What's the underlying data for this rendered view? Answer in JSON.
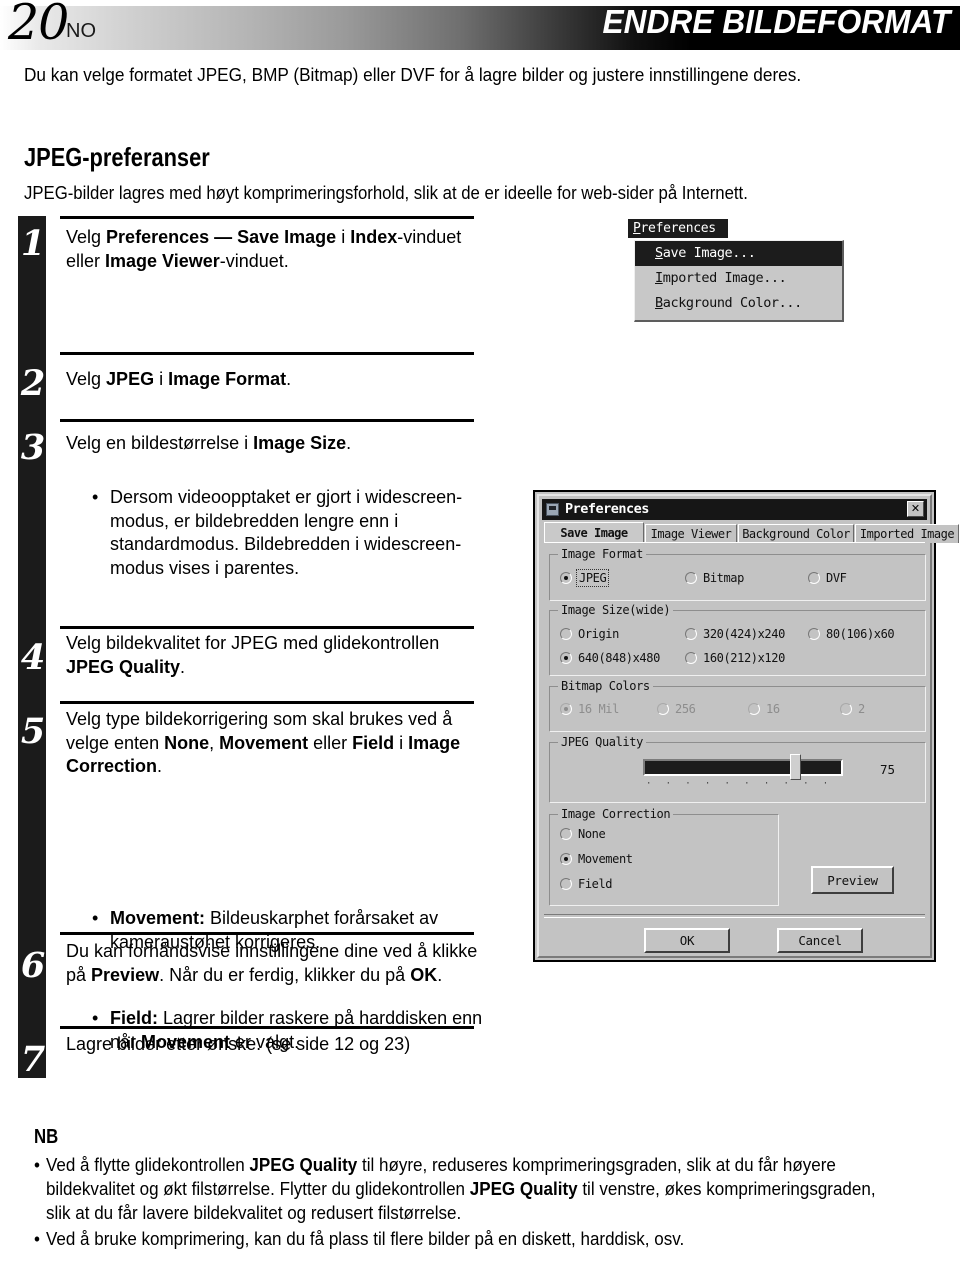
{
  "header": {
    "page_number": "20",
    "language": "NO",
    "title": "ENDRE BILDEFORMAT"
  },
  "intro": "Du kan velge formatet JPEG, BMP (Bitmap) eller DVF for å lagre bilder og justere innstillingene deres.",
  "section": {
    "heading": "JPEG-preferanser",
    "subtext": "JPEG-bilder lagres med høyt komprimeringsforhold, slik at de er ideelle for web-sider på Internett."
  },
  "steps": [
    {
      "num": "1",
      "html": "Velg <b>Preferences — Save Image</b> i <b>Index</b>-vinduet eller <b>Image Viewer</b>-vinduet."
    },
    {
      "num": "2",
      "html": "Velg <b>JPEG</b> i <b>Image Format</b>."
    },
    {
      "num": "3",
      "html": "Velg en bildestørrelse i <b>Image Size</b>."
    },
    {
      "num": "4",
      "html": "Velg bildekvalitet for JPEG med glidekontrollen <b>JPEG Quality</b>."
    },
    {
      "num": "5",
      "html": "Velg type bildekorrigering som skal brukes ved å velge enten <b>None</b>, <b>Movement</b> eller <b>Field</b> i <b>Image Correction</b>."
    },
    {
      "num": "6",
      "html": "Du kan forhåndsvise innstillingene dine ved å klikke på <b>Preview</b>. Når du er ferdig, klikker du på <b>OK</b>."
    },
    {
      "num": "7",
      "html": "Lagre bilder etter ønske. (se side 12 og 23)"
    }
  ],
  "bullets": {
    "step3": "Dersom videoopptaket er gjort i widescreen-modus, er bildebredden lengre enn i standardmodus. Bildebredden i widescreen-modus vises i parentes.",
    "step5_movement": "<b>Movement:</b> Bildeuskarphet forårsaket av kameraustøhet korrigeres.",
    "step5_field": "<b>Field:</b> Lagrer bilder raskere på harddisken enn når <b>Movement</b> er valgt."
  },
  "menu_screenshot": {
    "title": "Preferences",
    "items": [
      {
        "label": "Save Image...",
        "selected": true
      },
      {
        "label": "Imported Image...",
        "selected": false
      },
      {
        "label": "Background Color...",
        "selected": false
      }
    ]
  },
  "dialog": {
    "title": "Preferences",
    "close_label": "✕",
    "tabs": [
      {
        "label": "Save Image",
        "active": true
      },
      {
        "label": "Image Viewer",
        "active": false
      },
      {
        "label": "Background Color",
        "active": false
      },
      {
        "label": "Imported Image",
        "active": false
      }
    ],
    "image_format": {
      "legend": "Image Format",
      "options": [
        {
          "label": "JPEG",
          "selected": true,
          "focused": true
        },
        {
          "label": "Bitmap",
          "selected": false,
          "focused": false
        },
        {
          "label": "DVF",
          "selected": false,
          "focused": false
        }
      ]
    },
    "image_size": {
      "legend": "Image Size(wide)",
      "options": [
        {
          "label": "Origin",
          "selected": false
        },
        {
          "label": "320(424)x240",
          "selected": false
        },
        {
          "label": "80(106)x60",
          "selected": false
        },
        {
          "label": "640(848)x480",
          "selected": true
        },
        {
          "label": "160(212)x120",
          "selected": false
        }
      ]
    },
    "bitmap_colors": {
      "legend": "Bitmap Colors",
      "disabled": true,
      "options": [
        {
          "label": "16 Mil",
          "selected": true
        },
        {
          "label": "256",
          "selected": false
        },
        {
          "label": "16",
          "selected": false
        },
        {
          "label": "2",
          "selected": false
        }
      ]
    },
    "jpeg_quality": {
      "legend": "JPEG Quality",
      "value": "75",
      "percent": 72,
      "ticks": "· · · · · · · · · · · · · · · · · · · ·"
    },
    "image_correction": {
      "legend": "Image Correction",
      "options": [
        {
          "label": "None",
          "selected": false
        },
        {
          "label": "Movement",
          "selected": true
        },
        {
          "label": "Field",
          "selected": false
        }
      ]
    },
    "buttons": {
      "preview": "Preview",
      "ok": "OK",
      "cancel": "Cancel"
    }
  },
  "nb": {
    "heading": "NB",
    "items": [
      "Ved å flytte glidekontrollen <b>JPEG Quality</b> til høyre, reduseres komprimeringsgraden, slik at du får høyere bildekvalitet og økt filstørrelse. Flytter du glidekontrollen <b>JPEG Quality</b> til venstre, økes komprimeringsgraden, slik at du får lavere bildekvalitet og redusert filstørrelse.",
      "Ved å bruke komprimering, kan du få plass til flere bilder på en diskett, harddisk, osv."
    ]
  }
}
